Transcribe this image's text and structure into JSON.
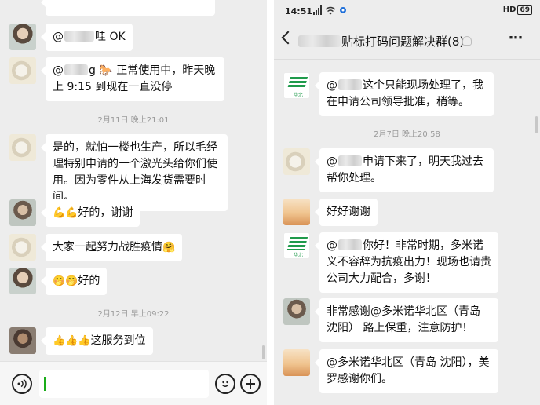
{
  "left": {
    "timestamps": [
      "2月11日 晚上21:01",
      "2月12日 早上09:22"
    ],
    "messages": [
      {
        "mention": "@",
        "text": "哇 OK"
      },
      {
        "mention": "@",
        "text": "g 🐎 正常使用中，昨天晚上 9:15 到现在一直没停"
      },
      {
        "text": "是的，就怕一楼也生产，所以毛经理特别申请的一个激光头给你们使用。因为零件从上海发货需要时间。"
      },
      {
        "emoji": "💪💪",
        "text": "好的，谢谢"
      },
      {
        "text": "大家一起努力战胜疫情",
        "emoji": "🤗"
      },
      {
        "emoji": "🤭🤭",
        "text": "好的"
      },
      {
        "emoji": "👍👍👍",
        "text": "这服务到位"
      }
    ],
    "input_placeholder": ""
  },
  "right": {
    "status_time": "14:51",
    "status_hd": "HD",
    "battery": "69",
    "chat_title": "贴标打码问题解决群(8)",
    "timestamps": [
      "2月7日 晚上20:58"
    ],
    "messages": [
      {
        "mention": "@",
        "text": "这个只能现场处理了，我在申请公司领导批准，稍等。"
      },
      {
        "mention": "@",
        "text": "申请下来了，明天我过去帮你处理。"
      },
      {
        "text": "好好谢谢"
      },
      {
        "mention": "@",
        "text": "你好！非常时期，多米诺义不容辞为抗疫出力！现场也请贵公司大力配合，多谢！"
      },
      {
        "text": "非常感谢@多米诺华北区（青岛 沈阳） 路上保重，注意防护！"
      },
      {
        "text": "@多米诺华北区（青岛 沈阳），美罗感谢你们。"
      }
    ],
    "avatar_logo_sub": "华北"
  },
  "icons": [
    "voice-icon",
    "emoji-icon",
    "plus-icon",
    "back-icon",
    "mute-icon",
    "more-icon",
    "wifi-icon",
    "signal-icon"
  ]
}
